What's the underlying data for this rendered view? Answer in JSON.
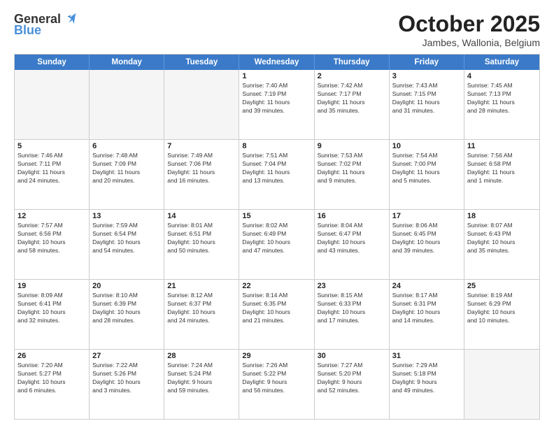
{
  "logo": {
    "general": "General",
    "blue": "Blue"
  },
  "title": "October 2025",
  "subtitle": "Jambes, Wallonia, Belgium",
  "header_days": [
    "Sunday",
    "Monday",
    "Tuesday",
    "Wednesday",
    "Thursday",
    "Friday",
    "Saturday"
  ],
  "weeks": [
    [
      {
        "day": "",
        "info": ""
      },
      {
        "day": "",
        "info": ""
      },
      {
        "day": "",
        "info": ""
      },
      {
        "day": "1",
        "info": "Sunrise: 7:40 AM\nSunset: 7:19 PM\nDaylight: 11 hours\nand 39 minutes."
      },
      {
        "day": "2",
        "info": "Sunrise: 7:42 AM\nSunset: 7:17 PM\nDaylight: 11 hours\nand 35 minutes."
      },
      {
        "day": "3",
        "info": "Sunrise: 7:43 AM\nSunset: 7:15 PM\nDaylight: 11 hours\nand 31 minutes."
      },
      {
        "day": "4",
        "info": "Sunrise: 7:45 AM\nSunset: 7:13 PM\nDaylight: 11 hours\nand 28 minutes."
      }
    ],
    [
      {
        "day": "5",
        "info": "Sunrise: 7:46 AM\nSunset: 7:11 PM\nDaylight: 11 hours\nand 24 minutes."
      },
      {
        "day": "6",
        "info": "Sunrise: 7:48 AM\nSunset: 7:09 PM\nDaylight: 11 hours\nand 20 minutes."
      },
      {
        "day": "7",
        "info": "Sunrise: 7:49 AM\nSunset: 7:06 PM\nDaylight: 11 hours\nand 16 minutes."
      },
      {
        "day": "8",
        "info": "Sunrise: 7:51 AM\nSunset: 7:04 PM\nDaylight: 11 hours\nand 13 minutes."
      },
      {
        "day": "9",
        "info": "Sunrise: 7:53 AM\nSunset: 7:02 PM\nDaylight: 11 hours\nand 9 minutes."
      },
      {
        "day": "10",
        "info": "Sunrise: 7:54 AM\nSunset: 7:00 PM\nDaylight: 11 hours\nand 5 minutes."
      },
      {
        "day": "11",
        "info": "Sunrise: 7:56 AM\nSunset: 6:58 PM\nDaylight: 11 hours\nand 1 minute."
      }
    ],
    [
      {
        "day": "12",
        "info": "Sunrise: 7:57 AM\nSunset: 6:56 PM\nDaylight: 10 hours\nand 58 minutes."
      },
      {
        "day": "13",
        "info": "Sunrise: 7:59 AM\nSunset: 6:54 PM\nDaylight: 10 hours\nand 54 minutes."
      },
      {
        "day": "14",
        "info": "Sunrise: 8:01 AM\nSunset: 6:51 PM\nDaylight: 10 hours\nand 50 minutes."
      },
      {
        "day": "15",
        "info": "Sunrise: 8:02 AM\nSunset: 6:49 PM\nDaylight: 10 hours\nand 47 minutes."
      },
      {
        "day": "16",
        "info": "Sunrise: 8:04 AM\nSunset: 6:47 PM\nDaylight: 10 hours\nand 43 minutes."
      },
      {
        "day": "17",
        "info": "Sunrise: 8:06 AM\nSunset: 6:45 PM\nDaylight: 10 hours\nand 39 minutes."
      },
      {
        "day": "18",
        "info": "Sunrise: 8:07 AM\nSunset: 6:43 PM\nDaylight: 10 hours\nand 35 minutes."
      }
    ],
    [
      {
        "day": "19",
        "info": "Sunrise: 8:09 AM\nSunset: 6:41 PM\nDaylight: 10 hours\nand 32 minutes."
      },
      {
        "day": "20",
        "info": "Sunrise: 8:10 AM\nSunset: 6:39 PM\nDaylight: 10 hours\nand 28 minutes."
      },
      {
        "day": "21",
        "info": "Sunrise: 8:12 AM\nSunset: 6:37 PM\nDaylight: 10 hours\nand 24 minutes."
      },
      {
        "day": "22",
        "info": "Sunrise: 8:14 AM\nSunset: 6:35 PM\nDaylight: 10 hours\nand 21 minutes."
      },
      {
        "day": "23",
        "info": "Sunrise: 8:15 AM\nSunset: 6:33 PM\nDaylight: 10 hours\nand 17 minutes."
      },
      {
        "day": "24",
        "info": "Sunrise: 8:17 AM\nSunset: 6:31 PM\nDaylight: 10 hours\nand 14 minutes."
      },
      {
        "day": "25",
        "info": "Sunrise: 8:19 AM\nSunset: 6:29 PM\nDaylight: 10 hours\nand 10 minutes."
      }
    ],
    [
      {
        "day": "26",
        "info": "Sunrise: 7:20 AM\nSunset: 5:27 PM\nDaylight: 10 hours\nand 6 minutes."
      },
      {
        "day": "27",
        "info": "Sunrise: 7:22 AM\nSunset: 5:26 PM\nDaylight: 10 hours\nand 3 minutes."
      },
      {
        "day": "28",
        "info": "Sunrise: 7:24 AM\nSunset: 5:24 PM\nDaylight: 9 hours\nand 59 minutes."
      },
      {
        "day": "29",
        "info": "Sunrise: 7:26 AM\nSunset: 5:22 PM\nDaylight: 9 hours\nand 56 minutes."
      },
      {
        "day": "30",
        "info": "Sunrise: 7:27 AM\nSunset: 5:20 PM\nDaylight: 9 hours\nand 52 minutes."
      },
      {
        "day": "31",
        "info": "Sunrise: 7:29 AM\nSunset: 5:18 PM\nDaylight: 9 hours\nand 49 minutes."
      },
      {
        "day": "",
        "info": ""
      }
    ]
  ]
}
